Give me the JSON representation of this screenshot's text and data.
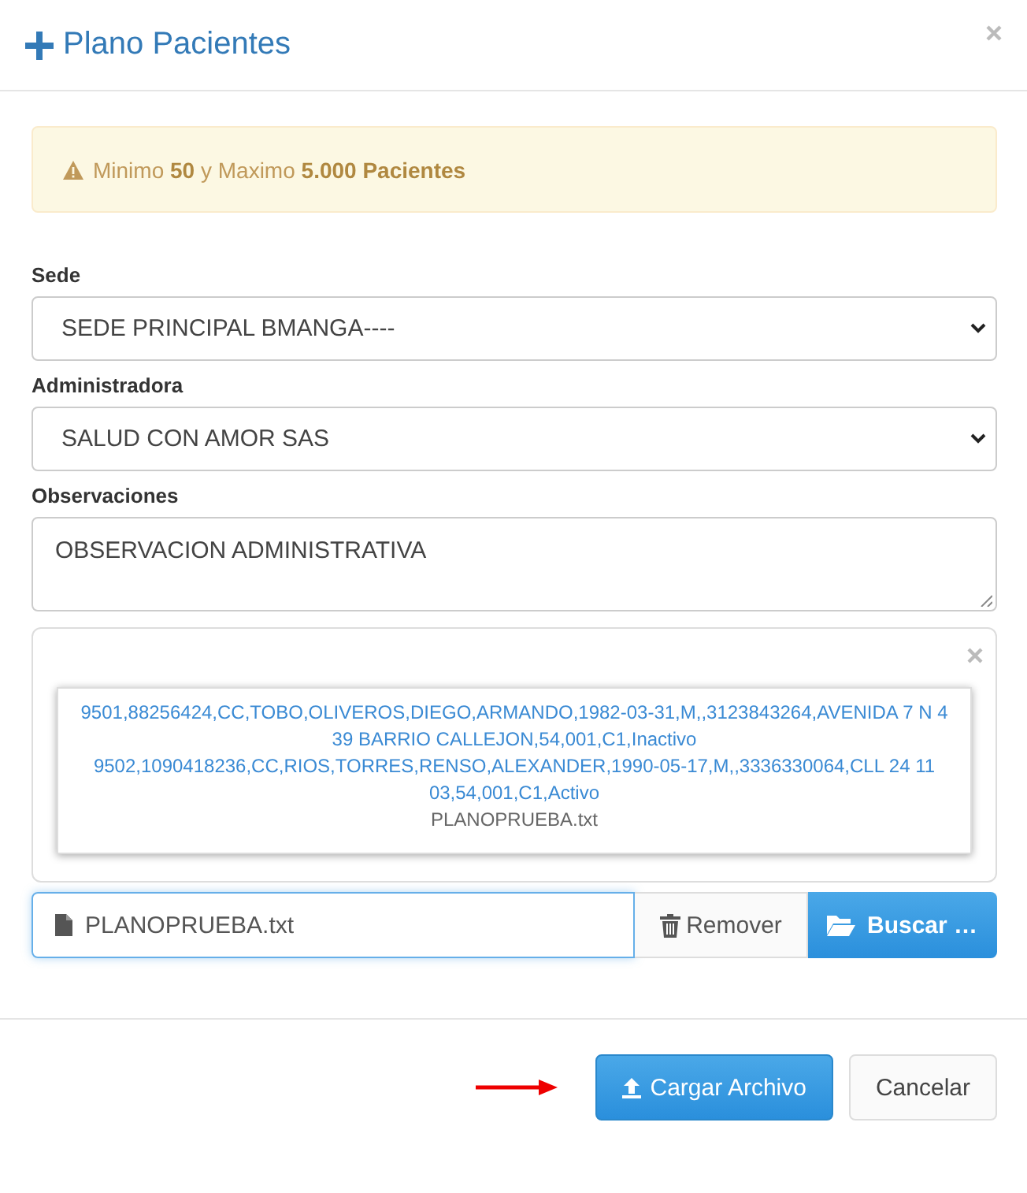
{
  "modal": {
    "title": "Plano Pacientes"
  },
  "alert": {
    "text": "Minimo **50** y Maximo **5.000 Pacientes**"
  },
  "fields": [
    {
      "label": "Sede",
      "kind": "select",
      "value": "SEDE PRINCIPAL BMANGA----"
    },
    {
      "label": "Administradora",
      "kind": "select",
      "value": "SALUD CON AMOR SAS"
    },
    {
      "label": "Observaciones",
      "kind": "textarea",
      "value": "OBSERVACION ADMINISTRATIVA"
    }
  ],
  "preview": {
    "lines": [
      "9501,88256424,CC,TOBO,OLIVEROS,DIEGO,ARMANDO,1982-03-31,M,,3123843264,AVENIDA 7 N 4 39 BARRIO CALLEJON,54,001,C1,Inactivo",
      "9502,1090418236,CC,RIOS,TORRES,RENSO,ALEXANDER,1990-05-17,M,,3336330064,CLL 24 11 03,54,001,C1,Activo"
    ],
    "filename": "PLANOPRUEBA.txt"
  },
  "file_input": {
    "value": "PLANOPRUEBA.txt",
    "remove_label": "Remover",
    "browse_label": "Buscar …"
  },
  "footer": {
    "buttons": [
      {
        "label": "Cargar Archivo",
        "kind": "primary"
      },
      {
        "label": "Cancelar",
        "kind": "default"
      }
    ]
  }
}
